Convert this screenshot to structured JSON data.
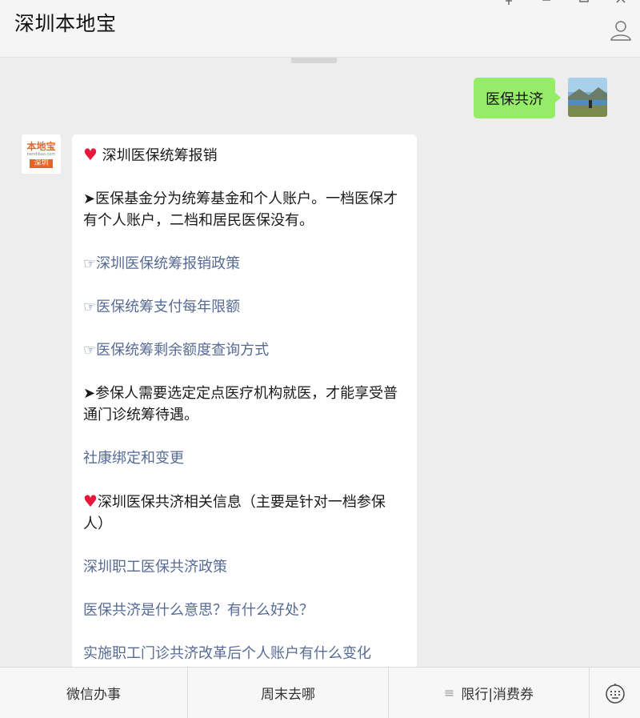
{
  "window": {
    "title": "深圳本地宝"
  },
  "outgoing_message": {
    "text": "医保共济"
  },
  "bot_avatar": {
    "logo_top": "本地宝",
    "logo_mid": "bendibao.com",
    "logo_bottom": "深圳"
  },
  "incoming_message": {
    "section1_heading": "深圳医保统筹报销",
    "para1": "➤医保基金分为统筹基金和个人账户。一档医保才有个人账户，二档和居民医保没有。",
    "link1": "☞深圳医保统筹报销政策",
    "link2": "☞医保统筹支付每年限额",
    "link3": "☞医保统筹剩余额度查询方式",
    "para2": "➤参保人需要选定定点医疗机构就医，才能享受普通门诊统筹待遇。",
    "link4": "社康绑定和变更",
    "section2_heading": "深圳医保共济相关信息（主要是针对一档参保人）",
    "link5": "深圳职工医保共济政策",
    "link6": "医保共济是什么意思？有什么好处？",
    "link7": "实施职工门诊共济改革后个人账户有什么变化"
  },
  "bottom_menu": {
    "item1": "微信办事",
    "item2": "周末去哪",
    "item3": "限行|消费券"
  },
  "colors": {
    "outgoing_bubble": "#95ec69",
    "link": "#576b95",
    "heart": "#e8173a",
    "logo_orange": "#e8632a"
  }
}
